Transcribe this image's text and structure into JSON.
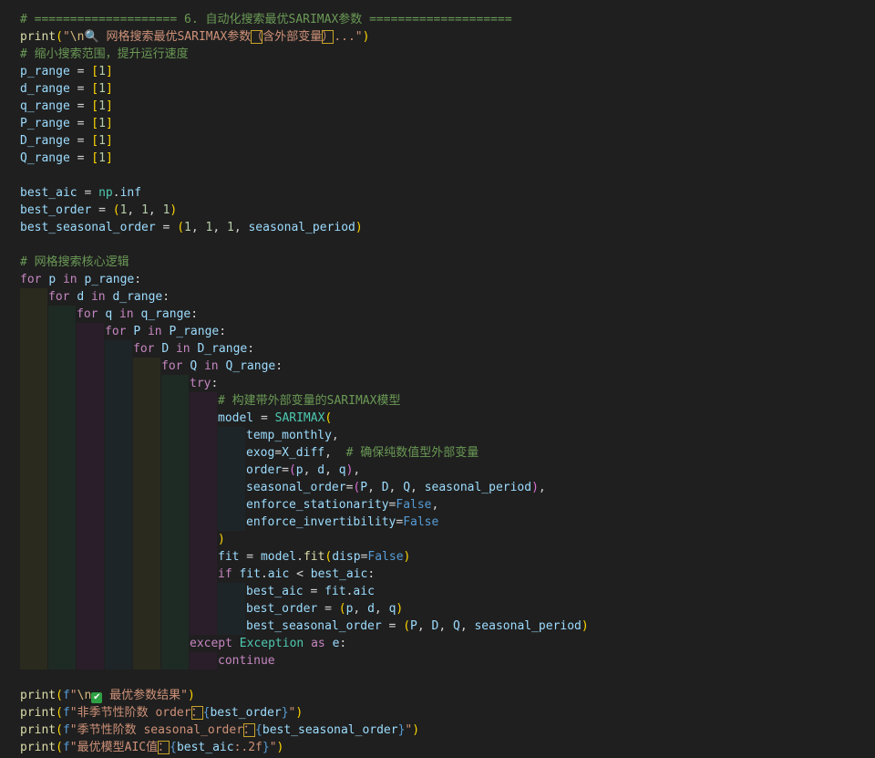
{
  "theme": {
    "background": "#1f1f1f",
    "comment": "#6a9955",
    "keyword": "#c586c0",
    "function": "#dcdcaa",
    "variable": "#9cdcfe",
    "string": "#ce9178",
    "number": "#b5cea8",
    "class": "#4ec9b0",
    "constant": "#569cd6",
    "indent_guide_colors": [
      "#2a2a1e",
      "#1e2a24",
      "#2a1e2a",
      "#1e2528"
    ]
  },
  "icons": {
    "search": "magnifier-icon",
    "check": "check-mark-icon"
  },
  "code_lines": [
    {
      "indent": 0,
      "tokens": [
        {
          "t": "# ==================== 6. 自动化搜索最优SARIMAX参数 ====================",
          "c": "cmt"
        }
      ]
    },
    {
      "indent": 0,
      "tokens": [
        {
          "t": "print",
          "c": "fn"
        },
        {
          "t": "(",
          "c": "brk1"
        },
        {
          "t": "\"",
          "c": "str"
        },
        {
          "t": "\\n",
          "c": "esc"
        },
        {
          "t": "🔍",
          "c": "str emoji"
        },
        {
          "t": " 网格搜索最优SARIMAX参数",
          "c": "str"
        },
        {
          "t": "（",
          "c": "str hl"
        },
        {
          "t": "含外部变量",
          "c": "str"
        },
        {
          "t": "）",
          "c": "str hl"
        },
        {
          "t": "...\"",
          "c": "str"
        },
        {
          "t": ")",
          "c": "brk1"
        }
      ]
    },
    {
      "indent": 0,
      "tokens": [
        {
          "t": "# 缩小搜索范围，提升运行速度",
          "c": "cmt"
        }
      ]
    },
    {
      "indent": 0,
      "tokens": [
        {
          "t": "p_range",
          "c": "var"
        },
        {
          "t": " = ",
          "c": "op"
        },
        {
          "t": "[",
          "c": "brk1"
        },
        {
          "t": "1",
          "c": "num"
        },
        {
          "t": "]",
          "c": "brk1"
        }
      ]
    },
    {
      "indent": 0,
      "tokens": [
        {
          "t": "d_range",
          "c": "var"
        },
        {
          "t": " = ",
          "c": "op"
        },
        {
          "t": "[",
          "c": "brk1"
        },
        {
          "t": "1",
          "c": "num"
        },
        {
          "t": "]",
          "c": "brk1"
        }
      ]
    },
    {
      "indent": 0,
      "tokens": [
        {
          "t": "q_range",
          "c": "var"
        },
        {
          "t": " = ",
          "c": "op"
        },
        {
          "t": "[",
          "c": "brk1"
        },
        {
          "t": "1",
          "c": "num"
        },
        {
          "t": "]",
          "c": "brk1"
        }
      ]
    },
    {
      "indent": 0,
      "tokens": [
        {
          "t": "P_range",
          "c": "var"
        },
        {
          "t": " = ",
          "c": "op"
        },
        {
          "t": "[",
          "c": "brk1"
        },
        {
          "t": "1",
          "c": "num"
        },
        {
          "t": "]",
          "c": "brk1"
        }
      ]
    },
    {
      "indent": 0,
      "tokens": [
        {
          "t": "D_range",
          "c": "var"
        },
        {
          "t": " = ",
          "c": "op"
        },
        {
          "t": "[",
          "c": "brk1"
        },
        {
          "t": "1",
          "c": "num"
        },
        {
          "t": "]",
          "c": "brk1"
        }
      ]
    },
    {
      "indent": 0,
      "tokens": [
        {
          "t": "Q_range",
          "c": "var"
        },
        {
          "t": " = ",
          "c": "op"
        },
        {
          "t": "[",
          "c": "brk1"
        },
        {
          "t": "1",
          "c": "num"
        },
        {
          "t": "]",
          "c": "brk1"
        }
      ]
    },
    {
      "indent": 0,
      "tokens": []
    },
    {
      "indent": 0,
      "tokens": [
        {
          "t": "best_aic",
          "c": "var"
        },
        {
          "t": " = ",
          "c": "op"
        },
        {
          "t": "np",
          "c": "cls"
        },
        {
          "t": ".",
          "c": "op"
        },
        {
          "t": "inf",
          "c": "var"
        }
      ]
    },
    {
      "indent": 0,
      "tokens": [
        {
          "t": "best_order",
          "c": "var"
        },
        {
          "t": " = ",
          "c": "op"
        },
        {
          "t": "(",
          "c": "brk1"
        },
        {
          "t": "1",
          "c": "num"
        },
        {
          "t": ", ",
          "c": "op"
        },
        {
          "t": "1",
          "c": "num"
        },
        {
          "t": ", ",
          "c": "op"
        },
        {
          "t": "1",
          "c": "num"
        },
        {
          "t": ")",
          "c": "brk1"
        }
      ]
    },
    {
      "indent": 0,
      "tokens": [
        {
          "t": "best_seasonal_order",
          "c": "var"
        },
        {
          "t": " = ",
          "c": "op"
        },
        {
          "t": "(",
          "c": "brk1"
        },
        {
          "t": "1",
          "c": "num"
        },
        {
          "t": ", ",
          "c": "op"
        },
        {
          "t": "1",
          "c": "num"
        },
        {
          "t": ", ",
          "c": "op"
        },
        {
          "t": "1",
          "c": "num"
        },
        {
          "t": ", ",
          "c": "op"
        },
        {
          "t": "seasonal_period",
          "c": "var"
        },
        {
          "t": ")",
          "c": "brk1"
        }
      ]
    },
    {
      "indent": 0,
      "tokens": []
    },
    {
      "indent": 0,
      "tokens": [
        {
          "t": "# 网格搜索核心逻辑",
          "c": "cmt"
        }
      ]
    },
    {
      "indent": 0,
      "tokens": [
        {
          "t": "for",
          "c": "kw"
        },
        {
          "t": " ",
          "c": "op"
        },
        {
          "t": "p",
          "c": "var"
        },
        {
          "t": " ",
          "c": "op"
        },
        {
          "t": "in",
          "c": "kw"
        },
        {
          "t": " ",
          "c": "op"
        },
        {
          "t": "p_range",
          "c": "var"
        },
        {
          "t": ":",
          "c": "op"
        }
      ]
    },
    {
      "indent": 1,
      "tokens": [
        {
          "t": "for",
          "c": "kw"
        },
        {
          "t": " ",
          "c": "op"
        },
        {
          "t": "d",
          "c": "var"
        },
        {
          "t": " ",
          "c": "op"
        },
        {
          "t": "in",
          "c": "kw"
        },
        {
          "t": " ",
          "c": "op"
        },
        {
          "t": "d_range",
          "c": "var"
        },
        {
          "t": ":",
          "c": "op"
        }
      ]
    },
    {
      "indent": 2,
      "tokens": [
        {
          "t": "for",
          "c": "kw"
        },
        {
          "t": " ",
          "c": "op"
        },
        {
          "t": "q",
          "c": "var"
        },
        {
          "t": " ",
          "c": "op"
        },
        {
          "t": "in",
          "c": "kw"
        },
        {
          "t": " ",
          "c": "op"
        },
        {
          "t": "q_range",
          "c": "var"
        },
        {
          "t": ":",
          "c": "op"
        }
      ]
    },
    {
      "indent": 3,
      "tokens": [
        {
          "t": "for",
          "c": "kw"
        },
        {
          "t": " ",
          "c": "op"
        },
        {
          "t": "P",
          "c": "var"
        },
        {
          "t": " ",
          "c": "op"
        },
        {
          "t": "in",
          "c": "kw"
        },
        {
          "t": " ",
          "c": "op"
        },
        {
          "t": "P_range",
          "c": "var"
        },
        {
          "t": ":",
          "c": "op"
        }
      ]
    },
    {
      "indent": 4,
      "tokens": [
        {
          "t": "for",
          "c": "kw"
        },
        {
          "t": " ",
          "c": "op"
        },
        {
          "t": "D",
          "c": "var"
        },
        {
          "t": " ",
          "c": "op"
        },
        {
          "t": "in",
          "c": "kw"
        },
        {
          "t": " ",
          "c": "op"
        },
        {
          "t": "D_range",
          "c": "var"
        },
        {
          "t": ":",
          "c": "op"
        }
      ]
    },
    {
      "indent": 5,
      "tokens": [
        {
          "t": "for",
          "c": "kw"
        },
        {
          "t": " ",
          "c": "op"
        },
        {
          "t": "Q",
          "c": "var"
        },
        {
          "t": " ",
          "c": "op"
        },
        {
          "t": "in",
          "c": "kw"
        },
        {
          "t": " ",
          "c": "op"
        },
        {
          "t": "Q_range",
          "c": "var"
        },
        {
          "t": ":",
          "c": "op"
        }
      ]
    },
    {
      "indent": 6,
      "tokens": [
        {
          "t": "try",
          "c": "kw"
        },
        {
          "t": ":",
          "c": "op"
        }
      ]
    },
    {
      "indent": 7,
      "tokens": [
        {
          "t": "# 构建带外部变量的SARIMAX模型",
          "c": "cmt"
        }
      ]
    },
    {
      "indent": 7,
      "tokens": [
        {
          "t": "model",
          "c": "var"
        },
        {
          "t": " = ",
          "c": "op"
        },
        {
          "t": "SARIMAX",
          "c": "cls"
        },
        {
          "t": "(",
          "c": "brk1"
        }
      ]
    },
    {
      "indent": 8,
      "tokens": [
        {
          "t": "temp_monthly",
          "c": "var"
        },
        {
          "t": ",",
          "c": "op"
        }
      ]
    },
    {
      "indent": 8,
      "tokens": [
        {
          "t": "exog",
          "c": "var"
        },
        {
          "t": "=",
          "c": "op"
        },
        {
          "t": "X_diff",
          "c": "var"
        },
        {
          "t": ",  ",
          "c": "op"
        },
        {
          "t": "# 确保纯数值型外部变量",
          "c": "cmt"
        }
      ]
    },
    {
      "indent": 8,
      "tokens": [
        {
          "t": "order",
          "c": "var"
        },
        {
          "t": "=",
          "c": "op"
        },
        {
          "t": "(",
          "c": "brk2"
        },
        {
          "t": "p",
          "c": "var"
        },
        {
          "t": ", ",
          "c": "op"
        },
        {
          "t": "d",
          "c": "var"
        },
        {
          "t": ", ",
          "c": "op"
        },
        {
          "t": "q",
          "c": "var"
        },
        {
          "t": ")",
          "c": "brk2"
        },
        {
          "t": ",",
          "c": "op"
        }
      ]
    },
    {
      "indent": 8,
      "tokens": [
        {
          "t": "seasonal_order",
          "c": "var"
        },
        {
          "t": "=",
          "c": "op"
        },
        {
          "t": "(",
          "c": "brk2"
        },
        {
          "t": "P",
          "c": "var"
        },
        {
          "t": ", ",
          "c": "op"
        },
        {
          "t": "D",
          "c": "var"
        },
        {
          "t": ", ",
          "c": "op"
        },
        {
          "t": "Q",
          "c": "var"
        },
        {
          "t": ", ",
          "c": "op"
        },
        {
          "t": "seasonal_period",
          "c": "var"
        },
        {
          "t": ")",
          "c": "brk2"
        },
        {
          "t": ",",
          "c": "op"
        }
      ]
    },
    {
      "indent": 8,
      "tokens": [
        {
          "t": "enforce_stationarity",
          "c": "var"
        },
        {
          "t": "=",
          "c": "op"
        },
        {
          "t": "False",
          "c": "bool"
        },
        {
          "t": ",",
          "c": "op"
        }
      ]
    },
    {
      "indent": 8,
      "tokens": [
        {
          "t": "enforce_invertibility",
          "c": "var"
        },
        {
          "t": "=",
          "c": "op"
        },
        {
          "t": "False",
          "c": "bool"
        }
      ]
    },
    {
      "indent": 7,
      "tokens": [
        {
          "t": ")",
          "c": "brk1"
        }
      ]
    },
    {
      "indent": 7,
      "tokens": [
        {
          "t": "fit",
          "c": "var"
        },
        {
          "t": " = ",
          "c": "op"
        },
        {
          "t": "model",
          "c": "var"
        },
        {
          "t": ".",
          "c": "op"
        },
        {
          "t": "fit",
          "c": "fn"
        },
        {
          "t": "(",
          "c": "brk1"
        },
        {
          "t": "disp",
          "c": "var"
        },
        {
          "t": "=",
          "c": "op"
        },
        {
          "t": "False",
          "c": "bool"
        },
        {
          "t": ")",
          "c": "brk1"
        }
      ]
    },
    {
      "indent": 7,
      "tokens": [
        {
          "t": "if",
          "c": "kw"
        },
        {
          "t": " ",
          "c": "op"
        },
        {
          "t": "fit",
          "c": "var"
        },
        {
          "t": ".",
          "c": "op"
        },
        {
          "t": "aic",
          "c": "var"
        },
        {
          "t": " < ",
          "c": "op"
        },
        {
          "t": "best_aic",
          "c": "var"
        },
        {
          "t": ":",
          "c": "op"
        }
      ]
    },
    {
      "indent": 8,
      "tokens": [
        {
          "t": "best_aic",
          "c": "var"
        },
        {
          "t": " = ",
          "c": "op"
        },
        {
          "t": "fit",
          "c": "var"
        },
        {
          "t": ".",
          "c": "op"
        },
        {
          "t": "aic",
          "c": "var"
        }
      ]
    },
    {
      "indent": 8,
      "tokens": [
        {
          "t": "best_order",
          "c": "var"
        },
        {
          "t": " = ",
          "c": "op"
        },
        {
          "t": "(",
          "c": "brk1"
        },
        {
          "t": "p",
          "c": "var"
        },
        {
          "t": ", ",
          "c": "op"
        },
        {
          "t": "d",
          "c": "var"
        },
        {
          "t": ", ",
          "c": "op"
        },
        {
          "t": "q",
          "c": "var"
        },
        {
          "t": ")",
          "c": "brk1"
        }
      ]
    },
    {
      "indent": 8,
      "tokens": [
        {
          "t": "best_seasonal_order",
          "c": "var"
        },
        {
          "t": " = ",
          "c": "op"
        },
        {
          "t": "(",
          "c": "brk1"
        },
        {
          "t": "P",
          "c": "var"
        },
        {
          "t": ", ",
          "c": "op"
        },
        {
          "t": "D",
          "c": "var"
        },
        {
          "t": ", ",
          "c": "op"
        },
        {
          "t": "Q",
          "c": "var"
        },
        {
          "t": ", ",
          "c": "op"
        },
        {
          "t": "seasonal_period",
          "c": "var"
        },
        {
          "t": ")",
          "c": "brk1"
        }
      ]
    },
    {
      "indent": 6,
      "tokens": [
        {
          "t": "except",
          "c": "kw"
        },
        {
          "t": " ",
          "c": "op"
        },
        {
          "t": "Exception",
          "c": "cls"
        },
        {
          "t": " ",
          "c": "op"
        },
        {
          "t": "as",
          "c": "kw"
        },
        {
          "t": " ",
          "c": "op"
        },
        {
          "t": "e",
          "c": "var"
        },
        {
          "t": ":",
          "c": "op"
        }
      ]
    },
    {
      "indent": 7,
      "tokens": [
        {
          "t": "continue",
          "c": "kw"
        }
      ]
    },
    {
      "indent": 0,
      "tokens": []
    },
    {
      "indent": 0,
      "tokens": [
        {
          "t": "print",
          "c": "fn"
        },
        {
          "t": "(",
          "c": "brk1"
        },
        {
          "t": "f",
          "c": "bool"
        },
        {
          "t": "\"",
          "c": "str"
        },
        {
          "t": "\\n",
          "c": "esc"
        },
        {
          "t": "✔",
          "c": "check"
        },
        {
          "t": " 最优参数结果\"",
          "c": "str"
        },
        {
          "t": ")",
          "c": "brk1"
        }
      ]
    },
    {
      "indent": 0,
      "tokens": [
        {
          "t": "print",
          "c": "fn"
        },
        {
          "t": "(",
          "c": "brk1"
        },
        {
          "t": "f",
          "c": "bool"
        },
        {
          "t": "\"非季节性阶数 order",
          "c": "str"
        },
        {
          "t": "：",
          "c": "str hl"
        },
        {
          "t": "{",
          "c": "bool"
        },
        {
          "t": "best_order",
          "c": "var"
        },
        {
          "t": "}",
          "c": "bool"
        },
        {
          "t": "\"",
          "c": "str"
        },
        {
          "t": ")",
          "c": "brk1"
        }
      ]
    },
    {
      "indent": 0,
      "tokens": [
        {
          "t": "print",
          "c": "fn"
        },
        {
          "t": "(",
          "c": "brk1"
        },
        {
          "t": "f",
          "c": "bool"
        },
        {
          "t": "\"季节性阶数 seasonal_order",
          "c": "str"
        },
        {
          "t": "：",
          "c": "str hl"
        },
        {
          "t": "{",
          "c": "bool"
        },
        {
          "t": "best_seasonal_order",
          "c": "var"
        },
        {
          "t": "}",
          "c": "bool"
        },
        {
          "t": "\"",
          "c": "str"
        },
        {
          "t": ")",
          "c": "brk1"
        }
      ]
    },
    {
      "indent": 0,
      "tokens": [
        {
          "t": "print",
          "c": "fn"
        },
        {
          "t": "(",
          "c": "brk1"
        },
        {
          "t": "f",
          "c": "bool"
        },
        {
          "t": "\"最优模型AIC值",
          "c": "str"
        },
        {
          "t": "：",
          "c": "str hl"
        },
        {
          "t": "{",
          "c": "bool"
        },
        {
          "t": "best_aic",
          "c": "var"
        },
        {
          "t": ":.2f",
          "c": "str"
        },
        {
          "t": "}",
          "c": "bool"
        },
        {
          "t": "\"",
          "c": "str"
        },
        {
          "t": ")",
          "c": "brk1"
        }
      ]
    }
  ]
}
